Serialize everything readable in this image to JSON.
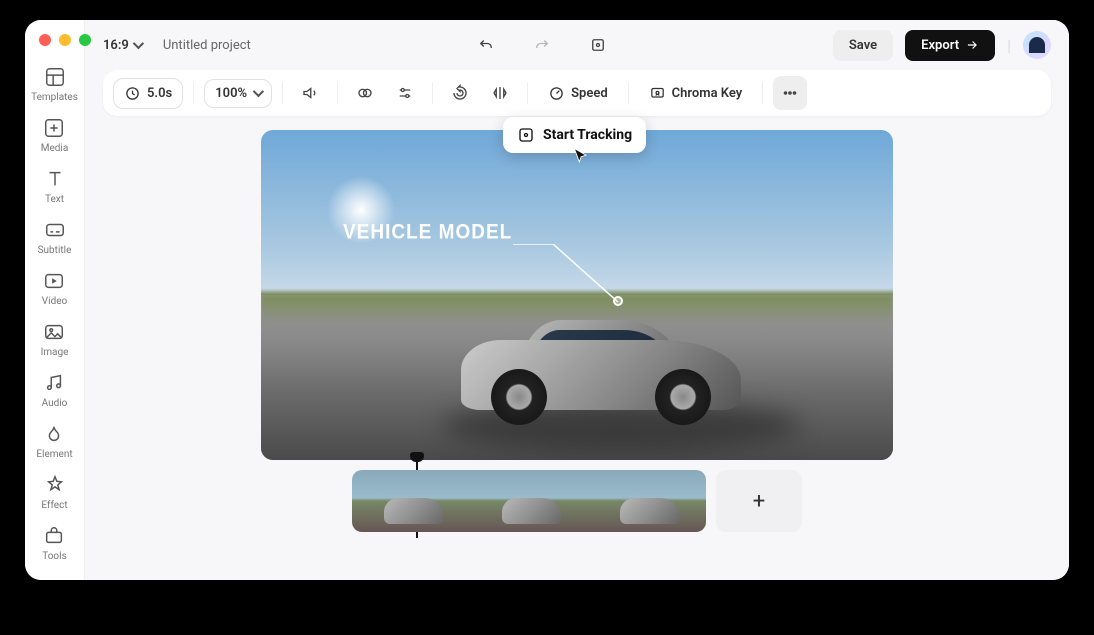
{
  "topbar": {
    "aspect_ratio": "16:9",
    "project_name": "Untitled project",
    "save_label": "Save",
    "export_label": "Export"
  },
  "sidebar": {
    "items": [
      {
        "label": "Templates"
      },
      {
        "label": "Media"
      },
      {
        "label": "Text"
      },
      {
        "label": "Subtitle"
      },
      {
        "label": "Video"
      },
      {
        "label": "Image"
      },
      {
        "label": "Audio"
      },
      {
        "label": "Element"
      },
      {
        "label": "Effect"
      },
      {
        "label": "Tools"
      }
    ]
  },
  "toolbar": {
    "duration": "5.0s",
    "zoom": "100%",
    "speed_label": "Speed",
    "chroma_label": "Chroma Key"
  },
  "canvas": {
    "callout_text": "VEHICLE MODEL"
  },
  "tooltip": {
    "label": "Start Tracking"
  },
  "timeline": {
    "add_label": "+"
  }
}
